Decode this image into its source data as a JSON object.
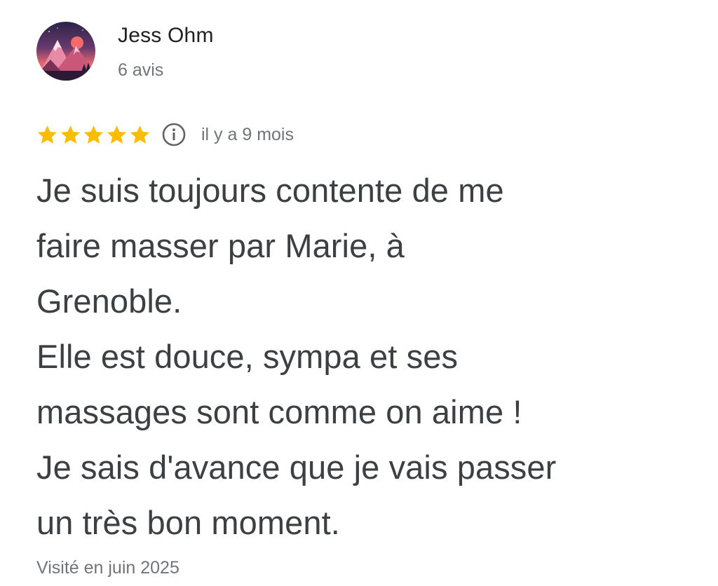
{
  "author": {
    "name": "Jess Ohm",
    "reviews_count": "6 avis",
    "avatar_icon": "mountain-avatar-icon"
  },
  "rating": {
    "stars": 5,
    "max_stars": 5,
    "star_color": "#fbbc04",
    "info_icon": "info-icon",
    "date": "il y a 9 mois"
  },
  "review": {
    "lines": [
      "Je suis toujours contente de me",
      "faire masser par Marie, à",
      "Grenoble.",
      "Elle est douce, sympa et ses",
      "massages sont comme on aime !",
      "Je sais d'avance que je vais passer",
      "un très bon moment."
    ]
  },
  "visit": {
    "text": "Visité en juin 2025"
  },
  "colors": {
    "text_primary": "#202124",
    "text_body": "#3c4043",
    "text_secondary": "#70757a",
    "star": "#fbbc04"
  }
}
